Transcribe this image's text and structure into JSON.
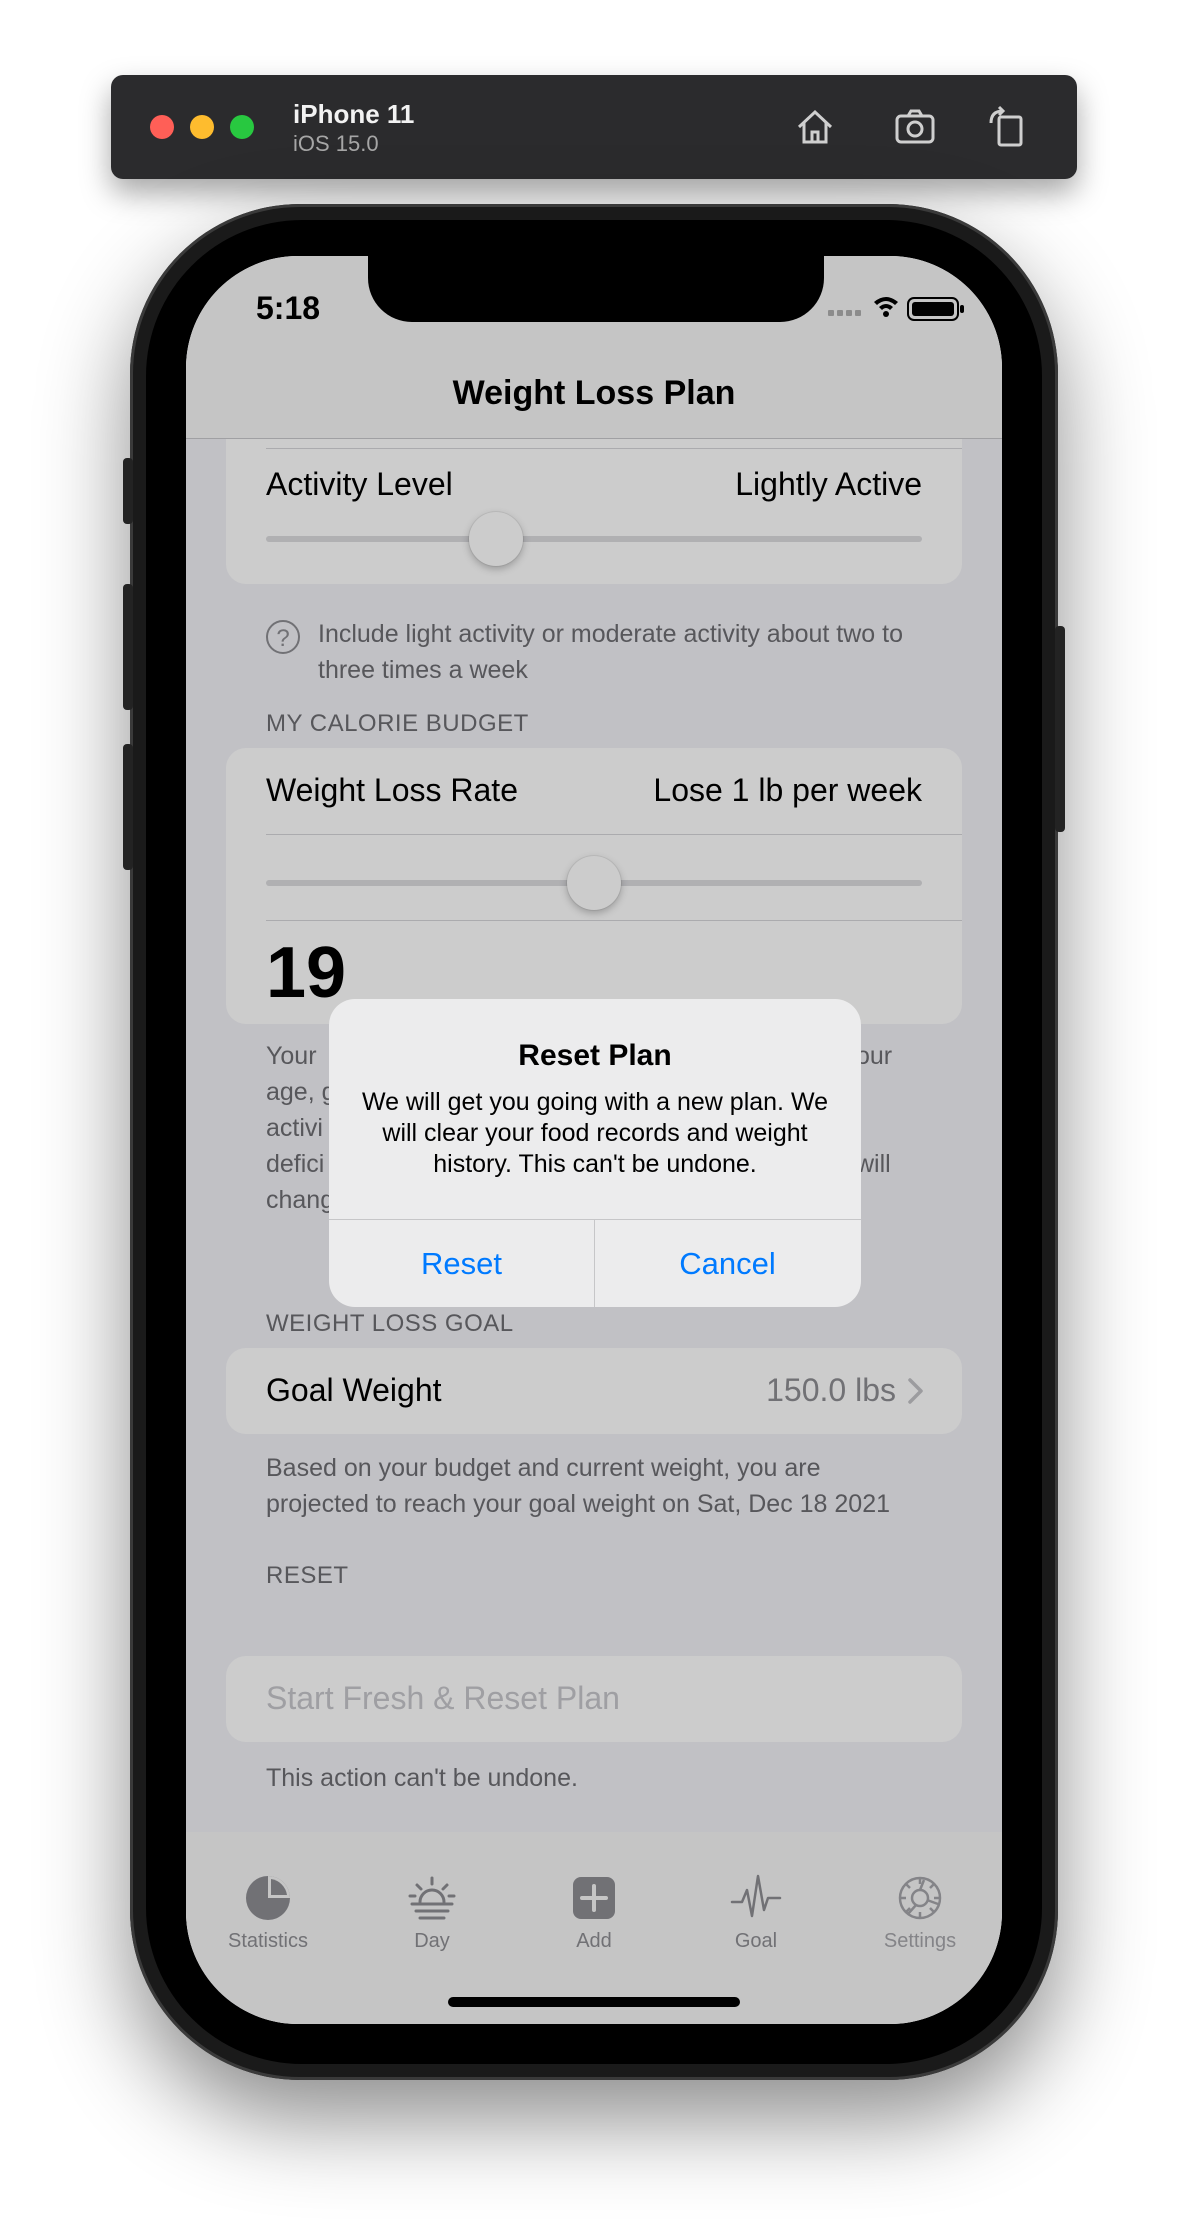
{
  "simulator": {
    "device_name": "iPhone 11",
    "os_version": "iOS 15.0",
    "icons": [
      "home-icon",
      "screenshot-icon",
      "rotate-icon"
    ]
  },
  "status_bar": {
    "time": "5:18"
  },
  "nav": {
    "title": "Weight Loss Plan"
  },
  "activity": {
    "label": "Activity Level",
    "value": "Lightly Active",
    "slider_fraction": 0.35,
    "help_text": "Include light activity or moderate activity about two to three times a week"
  },
  "calorie_budget": {
    "header": "MY CALORIE BUDGET",
    "rate_label": "Weight Loss Rate",
    "rate_value": "Lose 1 lb per week",
    "slider_fraction": 0.5,
    "calories_partial": "19",
    "footer_lines": [
      "Your",
      "age, g",
      "activi",
      "defici",
      "chang"
    ],
    "footer_right_lines": [
      "our",
      "will"
    ]
  },
  "goal": {
    "header": "WEIGHT LOSS GOAL",
    "label": "Goal Weight",
    "value": "150.0 lbs",
    "footer": "Based on your budget and current weight, you are projected to reach your goal weight on Sat, Dec 18 2021"
  },
  "reset": {
    "header": "RESET",
    "button_label": "Start Fresh & Reset Plan",
    "footer": "This action can't be undone."
  },
  "tabs": [
    {
      "label": "Statistics",
      "icon": "pie-chart-icon"
    },
    {
      "label": "Day",
      "icon": "sunrise-icon"
    },
    {
      "label": "Add",
      "icon": "plus-square-icon"
    },
    {
      "label": "Goal",
      "icon": "waveform-icon"
    },
    {
      "label": "Settings",
      "icon": "gear-icon"
    }
  ],
  "alert": {
    "title": "Reset Plan",
    "message": "We will get you going with a new plan. We will clear your food records and weight history. This can't be undone.",
    "confirm_label": "Reset",
    "cancel_label": "Cancel"
  },
  "colors": {
    "accent": "#007aff",
    "secondary_text": "#6d6d72",
    "group_background": "#f2f2f7"
  }
}
